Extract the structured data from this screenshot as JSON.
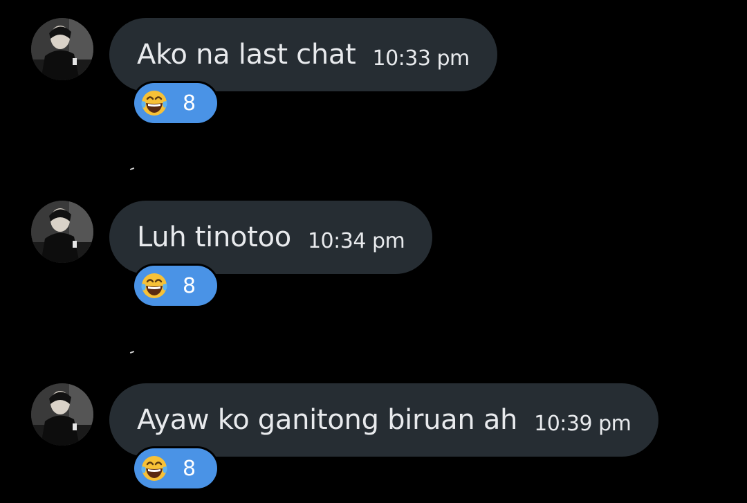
{
  "messages": [
    {
      "text": "Ako na last chat",
      "time": "10:33 pm",
      "reaction": {
        "emoji": "face-with-tears-of-joy",
        "count": "8"
      }
    },
    {
      "text": "Luh tinotoo",
      "time": "10:34 pm",
      "reaction": {
        "emoji": "face-with-tears-of-joy",
        "count": "8"
      }
    },
    {
      "text": "Ayaw ko ganitong biruan ah",
      "time": "10:39 pm",
      "reaction": {
        "emoji": "face-with-tears-of-joy",
        "count": "8"
      }
    }
  ],
  "colors": {
    "background": "#000000",
    "bubble": "#262d33",
    "text": "#e8eaed",
    "reaction_pill": "#4a93e6"
  }
}
